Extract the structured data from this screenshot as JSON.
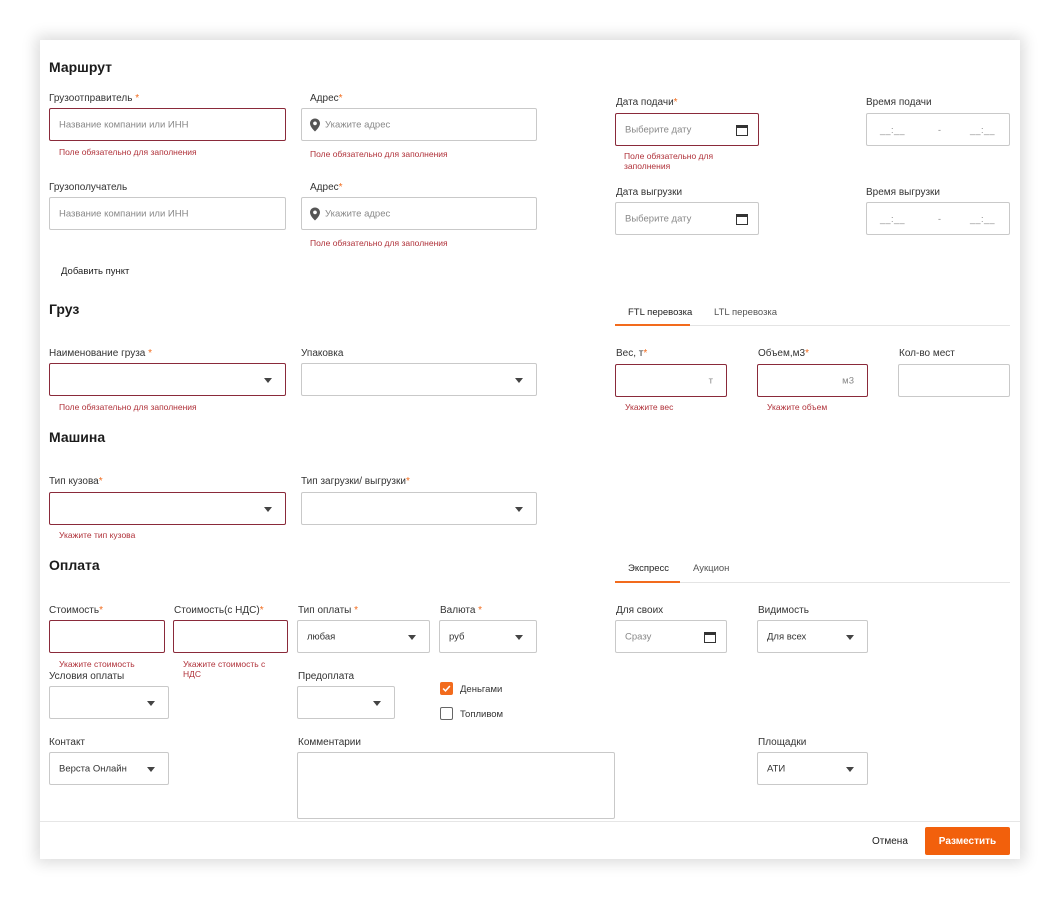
{
  "route": {
    "title": "Маршрут",
    "shipper": {
      "label": "Грузоотправитель",
      "required": "*",
      "placeholder": "Название компании или ИНН",
      "error": "Поле обязательно для заполнения"
    },
    "shipper_address": {
      "label": "Адрес",
      "required": "*",
      "placeholder": "Укажите адрес",
      "error": "Поле обязательно для заполнения"
    },
    "consignee": {
      "label": "Грузополучатель",
      "placeholder": "Название компании или ИНН"
    },
    "consignee_address": {
      "label": "Адрес",
      "required": "*",
      "placeholder": "Укажите адрес",
      "error": "Поле обязательно для заполнения"
    },
    "pickup_date": {
      "label": "Дата подачи",
      "required": "*",
      "placeholder": "Выберите дату",
      "error_line1": "Поле обязательно для",
      "error_line2": "заполнения"
    },
    "pickup_time": {
      "label": "Время подачи",
      "from": "__:__",
      "separator": "-",
      "to": "__:__"
    },
    "unload_date": {
      "label": "Дата выгрузки",
      "placeholder": "Выберите дату"
    },
    "unload_time": {
      "label": "Время выгрузки",
      "from": "__:__",
      "separator": "-",
      "to": "__:__"
    },
    "add_point": "Добавить пункт"
  },
  "cargo": {
    "title": "Груз",
    "tabs": [
      {
        "label": "FTL перевозка",
        "active": true
      },
      {
        "label": "LTL перевозка",
        "active": false
      }
    ],
    "name": {
      "label": "Наименование груза",
      "required": "*",
      "error": "Поле обязательно для заполнения"
    },
    "packaging": {
      "label": "Упаковка"
    },
    "weight": {
      "label": "Вес, т",
      "required": "*",
      "unit": "т",
      "error": "Укажите вес"
    },
    "volume": {
      "label": "Объем,м3",
      "required": "*",
      "unit": "м3",
      "error": "Укажите объем"
    },
    "places": {
      "label": "Кол-во мест"
    }
  },
  "vehicle": {
    "title": "Машина",
    "body_type": {
      "label": "Тип кузова",
      "required": "*",
      "error": "Укажите тип кузова"
    },
    "loading_type": {
      "label": "Тип загрузки/ выгрузки",
      "required": "*"
    }
  },
  "payment": {
    "title": "Оплата",
    "tabs": [
      {
        "label": "Экспресс",
        "active": true
      },
      {
        "label": "Аукцион",
        "active": false
      }
    ],
    "cost": {
      "label": "Стоимость",
      "required": "*",
      "error": "Укажите стоимость"
    },
    "cost_vat": {
      "label": "Стоимость(с НДС)",
      "required": "*",
      "error_line1": "Укажите стоимость с",
      "error_line2": "НДС"
    },
    "pay_type": {
      "label": "Тип оплаты",
      "required": "*",
      "value": "любая"
    },
    "currency": {
      "label": "Валюта",
      "required": "*",
      "value": "руб"
    },
    "for_own": {
      "label": "Для своих",
      "placeholder": "Сразу"
    },
    "visibility": {
      "label": "Видимость",
      "value": "Для всех"
    },
    "terms": {
      "label": "Условия оплаты"
    },
    "prepayment": {
      "label": "Предоплата"
    },
    "money": {
      "label": "Деньгами",
      "checked": true
    },
    "fuel": {
      "label": "Топливом",
      "checked": false
    },
    "contact": {
      "label": "Контакт",
      "value": "Верста Онлайн"
    },
    "comments": {
      "label": "Комментарии"
    },
    "platforms": {
      "label": "Площадки",
      "value": "АТИ"
    }
  },
  "footer": {
    "cancel": "Отмена",
    "submit": "Разместить"
  },
  "colors": {
    "accent": "#f26b1d",
    "error": "#b0323a",
    "invalid_border": "#8a2a3a"
  }
}
